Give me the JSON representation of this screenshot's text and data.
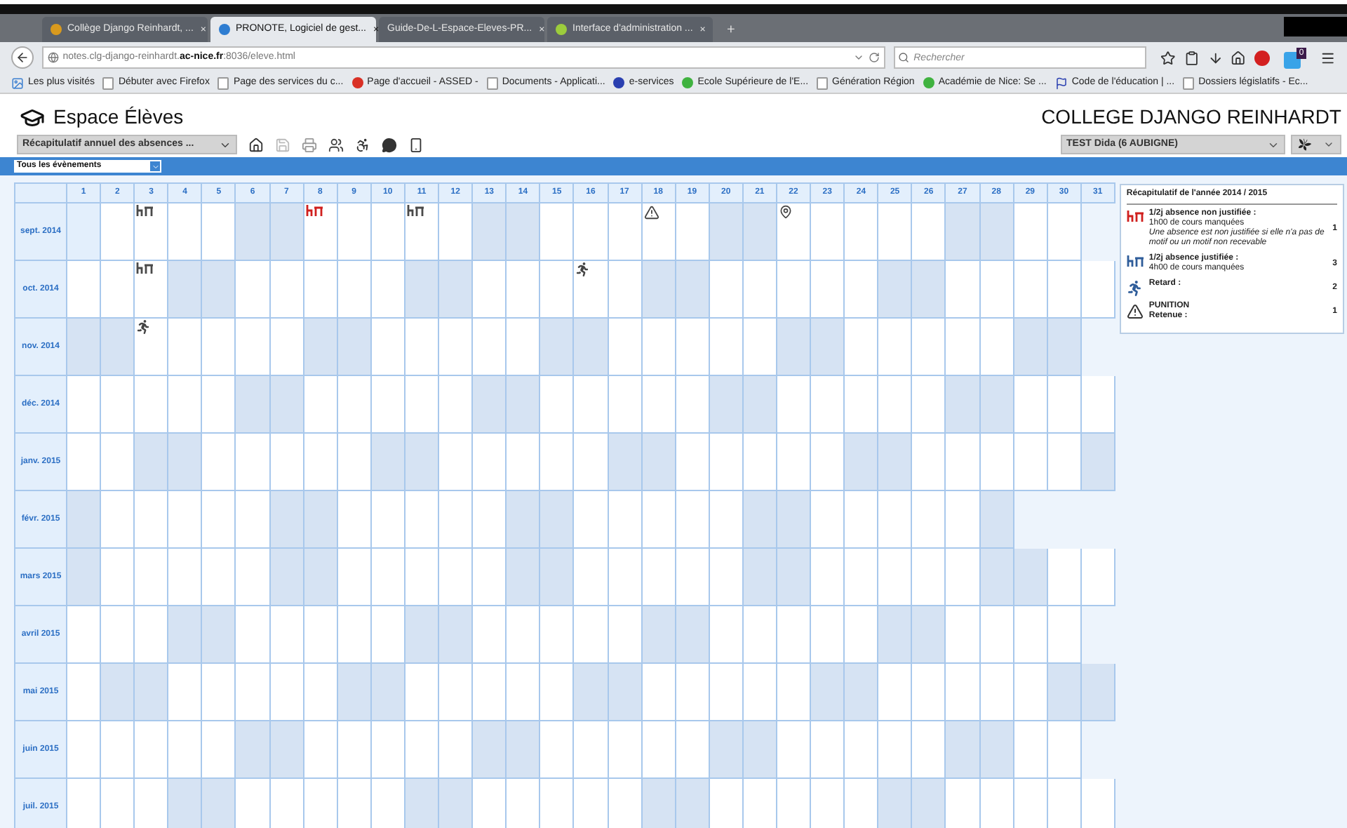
{
  "browser": {
    "tabs": [
      {
        "label": "Collège Django Reinhardt, ...",
        "close": "×",
        "selected": false,
        "color": "#d99a1e"
      },
      {
        "label": "PRONOTE, Logiciel de gest...",
        "close": "×",
        "selected": true,
        "color": "#2e7dd1"
      },
      {
        "label": "Guide-De-L-Espace-Eleves-PR...",
        "close": "×",
        "selected": false
      },
      {
        "label": "Interface d'administration ...",
        "close": "×",
        "selected": false,
        "color": "#9ccc3c"
      }
    ],
    "new_tab": "+",
    "url": "notes.clg-django-reinhardt.**ac-nice.fr**:8036/eleve.html",
    "search": {
      "placeholder": "Rechercher"
    },
    "badge": "0",
    "bookmarks": [
      {
        "label": "Les plus visités",
        "kind": "image"
      },
      {
        "label": "Débuter avec Firefox",
        "kind": "page"
      },
      {
        "label": "Page des services du c...",
        "kind": "page"
      },
      {
        "label": "Page d'accueil - ASSED -",
        "kind": "circle",
        "color": "#d93025"
      },
      {
        "label": "Documents - Applicati...",
        "kind": "page"
      },
      {
        "label": "e-services",
        "kind": "circle",
        "color": "#2a3fb0"
      },
      {
        "label": "Ecole Supérieure de l'E...",
        "kind": "circle",
        "color": "#3fb23f"
      },
      {
        "label": "Génération Région",
        "kind": "page"
      },
      {
        "label": "Académie de Nice: Se ...",
        "kind": "circle",
        "color": "#3fb23f"
      },
      {
        "label": "Code de l'éducation | ...",
        "kind": "flag"
      },
      {
        "label": "Dossiers législatifs - Ec...",
        "kind": "page"
      }
    ]
  },
  "app": {
    "title": "Espace Élèves",
    "school": "COLLEGE DJANGO REINHARDT",
    "view_select": "Récapitulatif annuel des absences ...",
    "student_select": "TEST Dida (6 AUBIGNE)",
    "filter": "Tous les évènements",
    "calendar": {
      "days": [
        "1",
        "2",
        "3",
        "4",
        "5",
        "6",
        "7",
        "8",
        "9",
        "10",
        "11",
        "12",
        "13",
        "14",
        "15",
        "16",
        "17",
        "18",
        "19",
        "20",
        "21",
        "22",
        "23",
        "24",
        "25",
        "26",
        "27",
        "28",
        "29",
        "30",
        "31"
      ],
      "months": [
        {
          "label": "sept. 2014",
          "cells": [
            {
              "kind": "holiday"
            },
            {
              "kind": "day"
            },
            {
              "kind": "justified"
            },
            {
              "kind": "day"
            },
            {
              "kind": "day"
            },
            {
              "kind": "weekend"
            },
            {
              "kind": "weekend"
            },
            {
              "kind": "unjustified"
            },
            {
              "kind": "day"
            },
            {
              "kind": "day"
            },
            {
              "kind": "justified"
            },
            {
              "kind": "day"
            },
            {
              "kind": "weekend"
            },
            {
              "kind": "weekend"
            },
            {
              "kind": "day"
            },
            {
              "kind": "day"
            },
            {
              "kind": "day"
            },
            {
              "kind": "punishment"
            },
            {
              "kind": "day"
            },
            {
              "kind": "weekend"
            },
            {
              "kind": "weekend"
            },
            {
              "kind": "pin"
            },
            {
              "kind": "day"
            },
            {
              "kind": "day"
            },
            {
              "kind": "day"
            },
            {
              "kind": "day"
            },
            {
              "kind": "weekend"
            },
            {
              "kind": "weekend"
            },
            {
              "kind": "day"
            },
            {
              "kind": "day"
            }
          ]
        },
        {
          "label": "oct. 2014",
          "cells": [
            {
              "kind": "day"
            },
            {
              "kind": "day"
            },
            {
              "kind": "justified"
            },
            {
              "kind": "weekend"
            },
            {
              "kind": "weekend"
            },
            {
              "kind": "day"
            },
            {
              "kind": "day"
            },
            {
              "kind": "day"
            },
            {
              "kind": "day"
            },
            {
              "kind": "day"
            },
            {
              "kind": "weekend"
            },
            {
              "kind": "weekend"
            },
            {
              "kind": "day"
            },
            {
              "kind": "day"
            },
            {
              "kind": "day"
            },
            {
              "kind": "late"
            },
            {
              "kind": "day"
            },
            {
              "kind": "weekend"
            },
            {
              "kind": "weekend"
            },
            {
              "kind": "day"
            },
            {
              "kind": "day"
            },
            {
              "kind": "day"
            },
            {
              "kind": "day"
            },
            {
              "kind": "day"
            },
            {
              "kind": "weekend"
            },
            {
              "kind": "weekend"
            },
            {
              "kind": "day"
            },
            {
              "kind": "day"
            },
            {
              "kind": "day"
            },
            {
              "kind": "day"
            },
            {
              "kind": "day"
            }
          ]
        },
        {
          "label": "nov. 2014",
          "cells": [
            {
              "kind": "weekend"
            },
            {
              "kind": "weekend"
            },
            {
              "kind": "late"
            },
            {
              "kind": "day"
            },
            {
              "kind": "day"
            },
            {
              "kind": "day"
            },
            {
              "kind": "day"
            },
            {
              "kind": "weekend"
            },
            {
              "kind": "weekend"
            },
            {
              "kind": "day"
            },
            {
              "kind": "day"
            },
            {
              "kind": "day"
            },
            {
              "kind": "day"
            },
            {
              "kind": "day"
            },
            {
              "kind": "weekend"
            },
            {
              "kind": "weekend"
            },
            {
              "kind": "day"
            },
            {
              "kind": "day"
            },
            {
              "kind": "day"
            },
            {
              "kind": "day"
            },
            {
              "kind": "day"
            },
            {
              "kind": "weekend"
            },
            {
              "kind": "weekend"
            },
            {
              "kind": "day"
            },
            {
              "kind": "day"
            },
            {
              "kind": "day"
            },
            {
              "kind": "day"
            },
            {
              "kind": "day"
            },
            {
              "kind": "weekend"
            },
            {
              "kind": "weekend"
            }
          ]
        },
        {
          "label": "déc. 2014",
          "cells": [
            {
              "kind": "day"
            },
            {
              "kind": "day"
            },
            {
              "kind": "day"
            },
            {
              "kind": "day"
            },
            {
              "kind": "day"
            },
            {
              "kind": "weekend"
            },
            {
              "kind": "weekend"
            },
            {
              "kind": "day"
            },
            {
              "kind": "day"
            },
            {
              "kind": "day"
            },
            {
              "kind": "day"
            },
            {
              "kind": "day"
            },
            {
              "kind": "weekend"
            },
            {
              "kind": "weekend"
            },
            {
              "kind": "day"
            },
            {
              "kind": "day"
            },
            {
              "kind": "day"
            },
            {
              "kind": "day"
            },
            {
              "kind": "day"
            },
            {
              "kind": "weekend"
            },
            {
              "kind": "weekend"
            },
            {
              "kind": "day"
            },
            {
              "kind": "day"
            },
            {
              "kind": "day"
            },
            {
              "kind": "day"
            },
            {
              "kind": "day"
            },
            {
              "kind": "weekend"
            },
            {
              "kind": "weekend"
            },
            {
              "kind": "day"
            },
            {
              "kind": "day"
            },
            {
              "kind": "day"
            }
          ]
        },
        {
          "label": "janv. 2015",
          "cells": [
            {
              "kind": "day"
            },
            {
              "kind": "day"
            },
            {
              "kind": "weekend"
            },
            {
              "kind": "weekend"
            },
            {
              "kind": "day"
            },
            {
              "kind": "day"
            },
            {
              "kind": "day"
            },
            {
              "kind": "day"
            },
            {
              "kind": "day"
            },
            {
              "kind": "weekend"
            },
            {
              "kind": "weekend"
            },
            {
              "kind": "day"
            },
            {
              "kind": "day"
            },
            {
              "kind": "day"
            },
            {
              "kind": "day"
            },
            {
              "kind": "day"
            },
            {
              "kind": "weekend"
            },
            {
              "kind": "weekend"
            },
            {
              "kind": "day"
            },
            {
              "kind": "day"
            },
            {
              "kind": "day"
            },
            {
              "kind": "day"
            },
            {
              "kind": "day"
            },
            {
              "kind": "weekend"
            },
            {
              "kind": "weekend"
            },
            {
              "kind": "day"
            },
            {
              "kind": "day"
            },
            {
              "kind": "day"
            },
            {
              "kind": "day"
            },
            {
              "kind": "day"
            },
            {
              "kind": "weekend"
            }
          ]
        },
        {
          "label": "févr. 2015",
          "cells": [
            {
              "kind": "weekend"
            },
            {
              "kind": "day"
            },
            {
              "kind": "day"
            },
            {
              "kind": "day"
            },
            {
              "kind": "day"
            },
            {
              "kind": "day"
            },
            {
              "kind": "weekend"
            },
            {
              "kind": "weekend"
            },
            {
              "kind": "day"
            },
            {
              "kind": "day"
            },
            {
              "kind": "day"
            },
            {
              "kind": "day"
            },
            {
              "kind": "day"
            },
            {
              "kind": "weekend"
            },
            {
              "kind": "weekend"
            },
            {
              "kind": "day"
            },
            {
              "kind": "day"
            },
            {
              "kind": "day"
            },
            {
              "kind": "day"
            },
            {
              "kind": "day"
            },
            {
              "kind": "weekend"
            },
            {
              "kind": "weekend"
            },
            {
              "kind": "day"
            },
            {
              "kind": "day"
            },
            {
              "kind": "day"
            },
            {
              "kind": "day"
            },
            {
              "kind": "day"
            },
            {
              "kind": "weekend"
            }
          ]
        },
        {
          "label": "mars 2015",
          "cells": [
            {
              "kind": "weekend"
            },
            {
              "kind": "day"
            },
            {
              "kind": "day"
            },
            {
              "kind": "day"
            },
            {
              "kind": "day"
            },
            {
              "kind": "day"
            },
            {
              "kind": "weekend"
            },
            {
              "kind": "weekend"
            },
            {
              "kind": "day"
            },
            {
              "kind": "day"
            },
            {
              "kind": "day"
            },
            {
              "kind": "day"
            },
            {
              "kind": "day"
            },
            {
              "kind": "weekend"
            },
            {
              "kind": "weekend"
            },
            {
              "kind": "day"
            },
            {
              "kind": "day"
            },
            {
              "kind": "day"
            },
            {
              "kind": "day"
            },
            {
              "kind": "day"
            },
            {
              "kind": "weekend"
            },
            {
              "kind": "weekend"
            },
            {
              "kind": "day"
            },
            {
              "kind": "day"
            },
            {
              "kind": "day"
            },
            {
              "kind": "day"
            },
            {
              "kind": "day"
            },
            {
              "kind": "weekend"
            },
            {
              "kind": "weekend"
            },
            {
              "kind": "day"
            },
            {
              "kind": "day"
            }
          ]
        },
        {
          "label": "avril 2015",
          "cells": [
            {
              "kind": "day"
            },
            {
              "kind": "day"
            },
            {
              "kind": "day"
            },
            {
              "kind": "weekend"
            },
            {
              "kind": "weekend"
            },
            {
              "kind": "day"
            },
            {
              "kind": "day"
            },
            {
              "kind": "day"
            },
            {
              "kind": "day"
            },
            {
              "kind": "day"
            },
            {
              "kind": "weekend"
            },
            {
              "kind": "weekend"
            },
            {
              "kind": "day"
            },
            {
              "kind": "day"
            },
            {
              "kind": "day"
            },
            {
              "kind": "day"
            },
            {
              "kind": "day"
            },
            {
              "kind": "weekend"
            },
            {
              "kind": "weekend"
            },
            {
              "kind": "day"
            },
            {
              "kind": "day"
            },
            {
              "kind": "day"
            },
            {
              "kind": "day"
            },
            {
              "kind": "day"
            },
            {
              "kind": "weekend"
            },
            {
              "kind": "weekend"
            },
            {
              "kind": "day"
            },
            {
              "kind": "day"
            },
            {
              "kind": "day"
            },
            {
              "kind": "day"
            }
          ]
        },
        {
          "label": "mai 2015",
          "cells": [
            {
              "kind": "day"
            },
            {
              "kind": "weekend"
            },
            {
              "kind": "weekend"
            },
            {
              "kind": "day"
            },
            {
              "kind": "day"
            },
            {
              "kind": "day"
            },
            {
              "kind": "day"
            },
            {
              "kind": "day"
            },
            {
              "kind": "weekend"
            },
            {
              "kind": "weekend"
            },
            {
              "kind": "day"
            },
            {
              "kind": "day"
            },
            {
              "kind": "day"
            },
            {
              "kind": "day"
            },
            {
              "kind": "day"
            },
            {
              "kind": "weekend"
            },
            {
              "kind": "weekend"
            },
            {
              "kind": "day"
            },
            {
              "kind": "day"
            },
            {
              "kind": "day"
            },
            {
              "kind": "day"
            },
            {
              "kind": "day"
            },
            {
              "kind": "weekend"
            },
            {
              "kind": "weekend"
            },
            {
              "kind": "day"
            },
            {
              "kind": "day"
            },
            {
              "kind": "day"
            },
            {
              "kind": "day"
            },
            {
              "kind": "day"
            },
            {
              "kind": "weekend"
            },
            {
              "kind": "weekend"
            }
          ]
        },
        {
          "label": "juin 2015",
          "cells": [
            {
              "kind": "day"
            },
            {
              "kind": "day"
            },
            {
              "kind": "day"
            },
            {
              "kind": "day"
            },
            {
              "kind": "day"
            },
            {
              "kind": "weekend"
            },
            {
              "kind": "weekend"
            },
            {
              "kind": "day"
            },
            {
              "kind": "day"
            },
            {
              "kind": "day"
            },
            {
              "kind": "day"
            },
            {
              "kind": "day"
            },
            {
              "kind": "weekend"
            },
            {
              "kind": "weekend"
            },
            {
              "kind": "day"
            },
            {
              "kind": "day"
            },
            {
              "kind": "day"
            },
            {
              "kind": "day"
            },
            {
              "kind": "day"
            },
            {
              "kind": "weekend"
            },
            {
              "kind": "weekend"
            },
            {
              "kind": "day"
            },
            {
              "kind": "day"
            },
            {
              "kind": "day"
            },
            {
              "kind": "day"
            },
            {
              "kind": "day"
            },
            {
              "kind": "weekend"
            },
            {
              "kind": "weekend"
            },
            {
              "kind": "day"
            },
            {
              "kind": "day"
            }
          ]
        },
        {
          "label": "juil. 2015",
          "cells": [
            {
              "kind": "day"
            },
            {
              "kind": "day"
            },
            {
              "kind": "day"
            },
            {
              "kind": "weekend"
            },
            {
              "kind": "weekend"
            },
            {
              "kind": "day"
            },
            {
              "kind": "day"
            },
            {
              "kind": "day"
            },
            {
              "kind": "day"
            },
            {
              "kind": "day"
            },
            {
              "kind": "weekend"
            },
            {
              "kind": "weekend"
            },
            {
              "kind": "day"
            },
            {
              "kind": "day"
            },
            {
              "kind": "day"
            },
            {
              "kind": "day"
            },
            {
              "kind": "day"
            },
            {
              "kind": "weekend"
            },
            {
              "kind": "weekend"
            },
            {
              "kind": "day"
            },
            {
              "kind": "day"
            },
            {
              "kind": "day"
            },
            {
              "kind": "day"
            },
            {
              "kind": "day"
            },
            {
              "kind": "weekend"
            },
            {
              "kind": "weekend"
            },
            {
              "kind": "day"
            },
            {
              "kind": "day"
            },
            {
              "kind": "day"
            },
            {
              "kind": "day"
            },
            {
              "kind": "day"
            }
          ]
        }
      ]
    },
    "summary": {
      "title": "Récapitulatif de l'année 2014 / 2015",
      "items": [
        {
          "kind": "unjustified",
          "label": "1/2j absence non justifiée :",
          "detail": "1h00 de cours manquées",
          "note": "Une absence est non justifiée si elle n'a pas de motif ou un motif non recevable",
          "count": "1"
        },
        {
          "kind": "justified",
          "label": "1/2j absence justifiée :",
          "detail": "4h00 de cours manquées",
          "count": "3"
        },
        {
          "kind": "late",
          "label": "Retard :",
          "count": "2"
        },
        {
          "kind": "punishment",
          "label": "PUNITION",
          "detail": "Retenue :",
          "count": "1"
        }
      ]
    }
  }
}
